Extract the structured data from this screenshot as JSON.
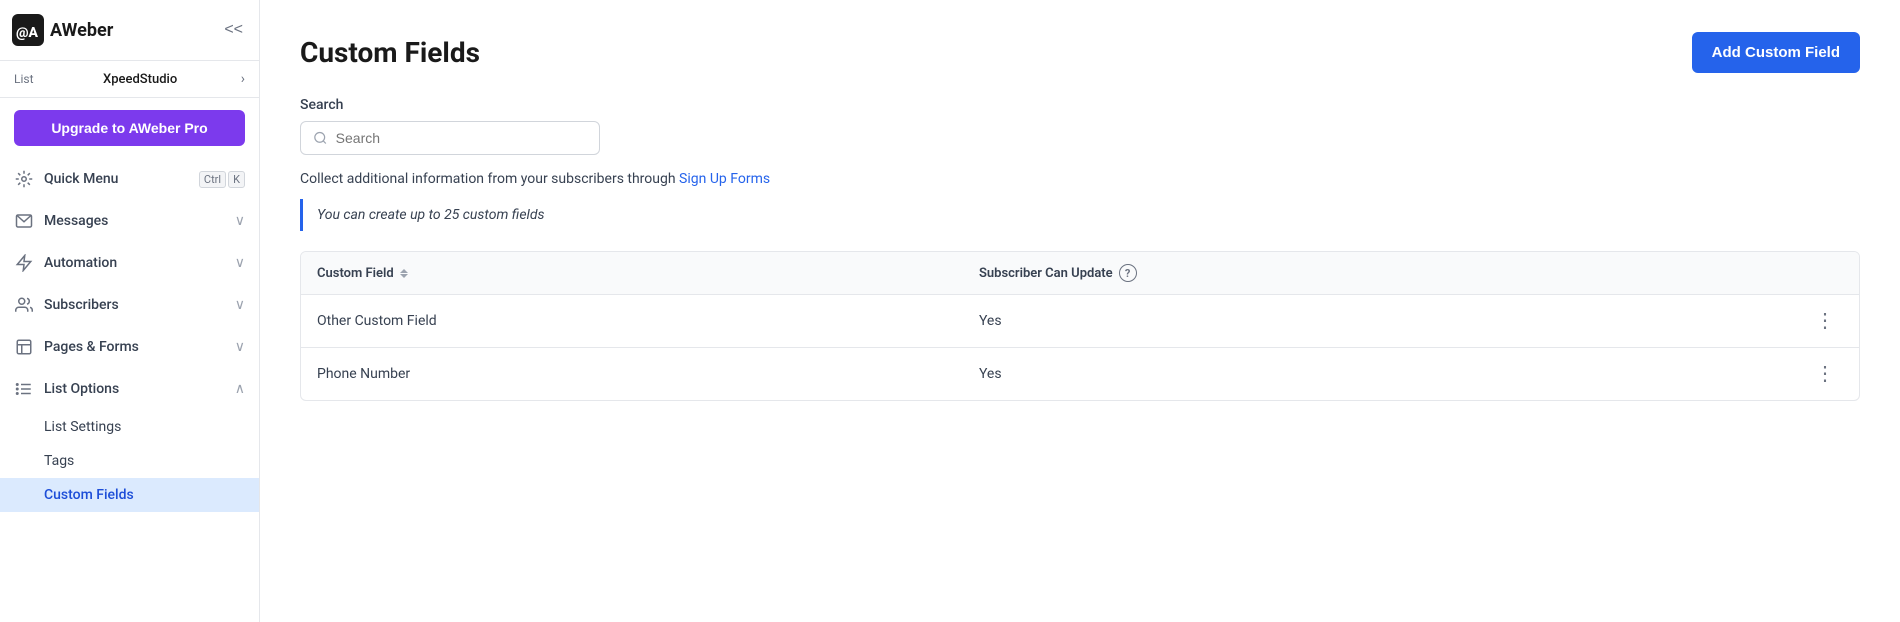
{
  "app": {
    "name": "AWeber",
    "logo_text": "AWeber"
  },
  "sidebar": {
    "collapse_label": "<<",
    "list": {
      "label": "List",
      "name": "XpeedStudio"
    },
    "upgrade_button": "Upgrade to AWeber Pro",
    "nav_items": [
      {
        "id": "quick-menu",
        "label": "Quick Menu",
        "shortcut": [
          "Ctrl",
          "K"
        ],
        "has_chevron": false
      },
      {
        "id": "messages",
        "label": "Messages",
        "has_chevron": true
      },
      {
        "id": "automation",
        "label": "Automation",
        "has_chevron": true
      },
      {
        "id": "subscribers",
        "label": "Subscribers",
        "has_chevron": true
      },
      {
        "id": "pages-forms",
        "label": "Pages & Forms",
        "has_chevron": true
      },
      {
        "id": "list-options",
        "label": "List Options",
        "has_chevron": true,
        "expanded": true
      }
    ],
    "sub_items": [
      {
        "id": "list-settings",
        "label": "List Settings",
        "active": false
      },
      {
        "id": "tags",
        "label": "Tags",
        "active": false
      },
      {
        "id": "custom-fields",
        "label": "Custom Fields",
        "active": true
      }
    ]
  },
  "main": {
    "title": "Custom Fields",
    "add_button": "Add Custom Field",
    "search": {
      "label": "Search",
      "placeholder": "Search"
    },
    "info_text_before": "Collect additional information from your subscribers through ",
    "info_link": "Sign Up Forms",
    "note": "You can create up to 25 custom fields",
    "table": {
      "columns": [
        {
          "id": "custom-field",
          "label": "Custom Field",
          "sortable": true
        },
        {
          "id": "subscriber-can-update",
          "label": "Subscriber Can Update",
          "has_help": true
        }
      ],
      "rows": [
        {
          "custom_field": "Other Custom Field",
          "subscriber_can_update": "Yes"
        },
        {
          "custom_field": "Phone Number",
          "subscriber_can_update": "Yes"
        }
      ]
    }
  }
}
